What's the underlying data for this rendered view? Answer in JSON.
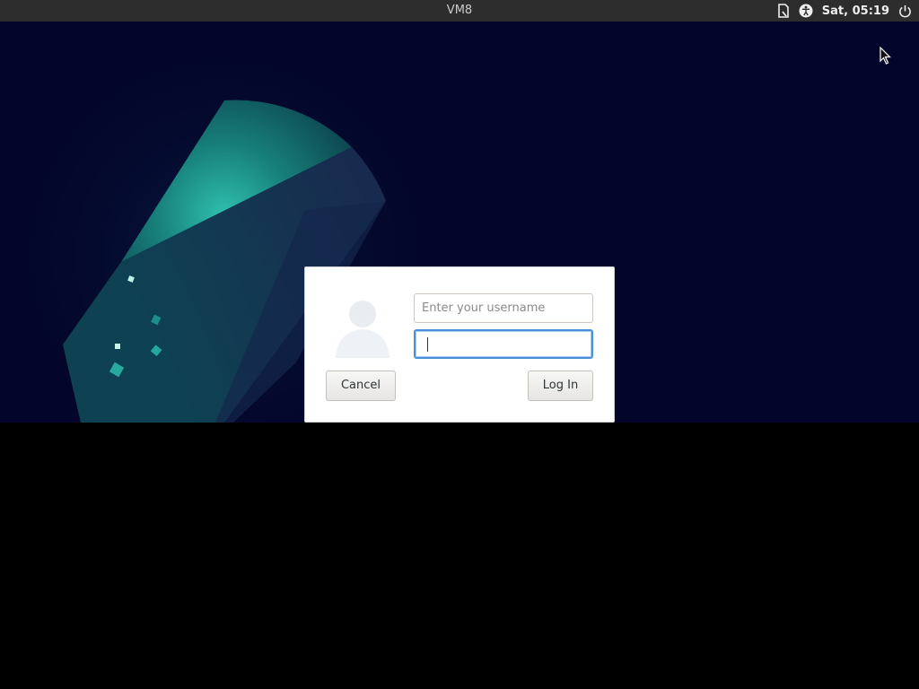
{
  "topbar": {
    "title": "VM8",
    "clock": "Sat, 05:19",
    "icons": [
      "document-icon",
      "accessibility-icon",
      "power-icon"
    ]
  },
  "login": {
    "username_placeholder": "Enter your username",
    "username_value": "",
    "password_value": "",
    "cancel_label": "Cancel",
    "login_label": "Log In"
  },
  "colors": {
    "topbar_bg": "#2d2d2d",
    "desktop_bg": "#03062a",
    "accent_teal": "#2cb3a5",
    "focus_ring": "#4a90d9"
  }
}
